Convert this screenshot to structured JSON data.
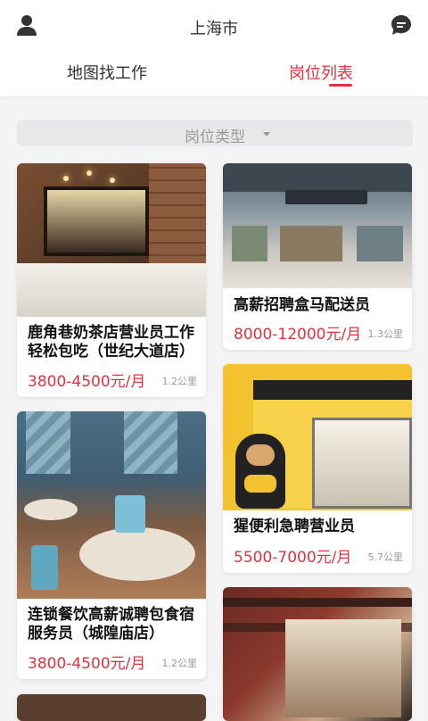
{
  "header": {
    "city": "上海市"
  },
  "tabs": {
    "map": "地图找工作",
    "list": "岗位列表"
  },
  "filter": {
    "label": "岗位类型"
  },
  "jobs": [
    {
      "name": "鹿角巷奶茶店营业员工作轻松包吃（世纪大道店）",
      "salary": "3800-4500元/月",
      "distance": "1.2公里"
    },
    {
      "name": "高薪招聘盒马配送员",
      "salary": "8000-12000元/月",
      "distance": "1.3公里"
    },
    {
      "name": "连锁餐饮高薪诚聘包食宿服务员（城隍庙店）",
      "salary": "3800-4500元/月",
      "distance": "1.2公里"
    },
    {
      "name": "猩便利急聘营业员",
      "salary": "5500-7000元/月",
      "distance": "5.7公里"
    }
  ],
  "icons": {
    "left": "user-icon",
    "right": "message-icon"
  },
  "colors": {
    "accent": "#e1323d"
  }
}
